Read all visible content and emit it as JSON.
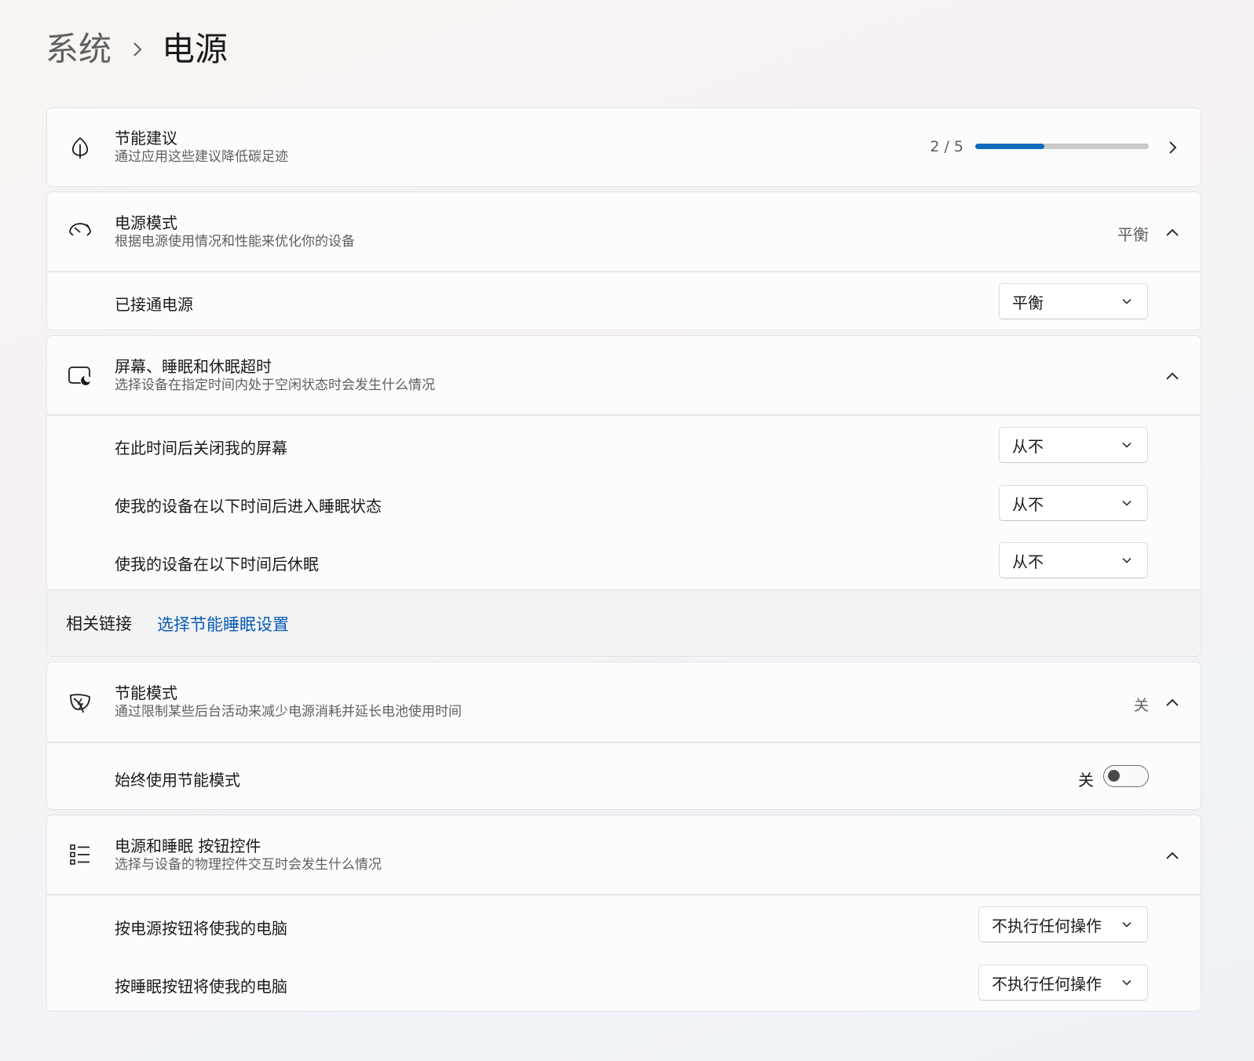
{
  "breadcrumb": {
    "parent": "系统",
    "current": "电源"
  },
  "energy_tips": {
    "title": "节能建议",
    "subtitle": "通过应用这些建议降低碳足迹",
    "progress_text": "2 / 5",
    "progress_fraction": 0.4
  },
  "power_mode": {
    "title": "电源模式",
    "subtitle": "根据电源使用情况和性能来优化你的设备",
    "status": "平衡",
    "plugged_in_label": "已接通电源",
    "plugged_in_value": "平衡"
  },
  "screen_sleep": {
    "title": "屏幕、睡眠和休眠超时",
    "subtitle": "选择设备在指定时间内处于空闲状态时会发生什么情况",
    "rows": [
      {
        "label": "在此时间后关闭我的屏幕",
        "value": "从不"
      },
      {
        "label": "使我的设备在以下时间后进入睡眠状态",
        "value": "从不"
      },
      {
        "label": "使我的设备在以下时间后休眠",
        "value": "从不"
      }
    ],
    "related_label": "相关链接",
    "related_link": "选择节能睡眠设置"
  },
  "energy_saver": {
    "title": "节能模式",
    "subtitle": "通过限制某些后台活动来减少电源消耗并延长电池使用时间",
    "status": "关",
    "always_label": "始终使用节能模式",
    "toggle_state": "关",
    "toggle_on": false
  },
  "buttons": {
    "title": "电源和睡眠 按钮控件",
    "subtitle": "选择与设备的物理控件交互时会发生什么情况",
    "rows": [
      {
        "label": "按电源按钮将使我的电脑",
        "value": "不执行任何操作"
      },
      {
        "label": "按睡眠按钮将使我的电脑",
        "value": "不执行任何操作"
      }
    ]
  },
  "colors": {
    "accent": "#0f6cbd",
    "link": "#0a5bb5"
  },
  "icons": [
    "leaf-icon",
    "gauge-icon",
    "screen-sleep-icon",
    "energy-saver-leaf-icon",
    "button-list-icon",
    "chevron-right-icon",
    "chevron-up-icon",
    "chevron-down-icon"
  ]
}
